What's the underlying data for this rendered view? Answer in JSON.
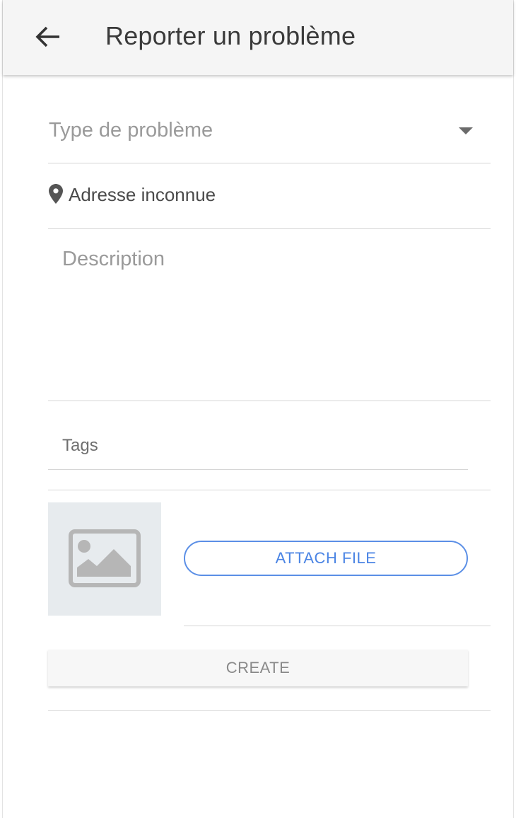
{
  "header": {
    "title": "Reporter un problème",
    "back_icon": "arrow-left-icon"
  },
  "form": {
    "problem_type": {
      "placeholder": "Type de problème",
      "icon": "caret-down-icon"
    },
    "address": {
      "icon": "location-pin-icon",
      "text": "Adresse inconnue"
    },
    "description": {
      "placeholder": "Description",
      "value": ""
    },
    "tags": {
      "placeholder": "Tags",
      "value": ""
    },
    "attachment": {
      "thumbnail_icon": "image-placeholder-icon",
      "button_label": "ATTACH FILE"
    },
    "create_label": "CREATE"
  },
  "colors": {
    "accent": "#4a84e4",
    "appbar_bg": "#f5f5f5",
    "divider": "#d6d6d6",
    "thumbnail_bg": "#e7ebee"
  }
}
